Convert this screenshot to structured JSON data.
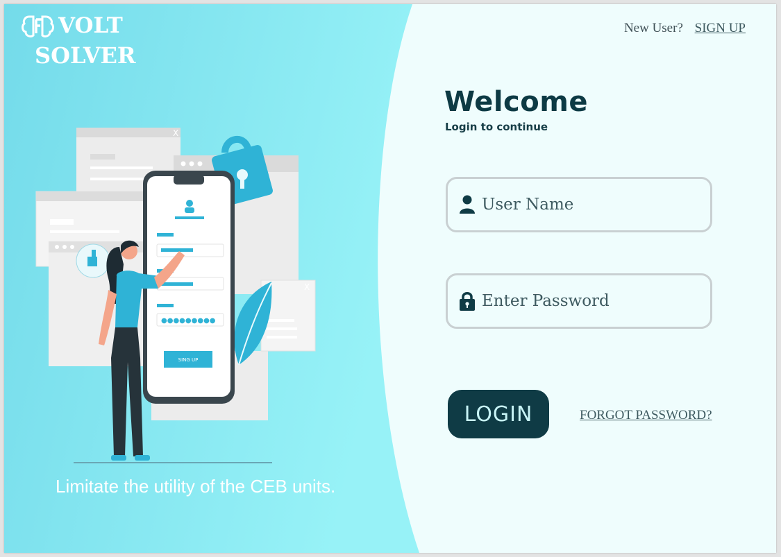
{
  "brand": {
    "line1": "VOLT",
    "line2": "SOLVER",
    "logo_icon": "brain-icon"
  },
  "header": {
    "new_user_text": "New User?",
    "signup_link": "SIGN UP"
  },
  "login": {
    "title": "Welcome",
    "subtitle": "Login to continue",
    "username_placeholder": "User Name",
    "password_placeholder": "Enter Password",
    "username_icon": "user-icon",
    "password_icon": "lock-icon",
    "login_button": "LOGIN",
    "forgot_link": "FORGOT PASSWORD?"
  },
  "illustration": {
    "phone_button_label": "SING UP"
  },
  "tagline": "Limitate the utility of the CEB units.",
  "colors": {
    "left_bg_start": "#74dbea",
    "left_bg_end": "#97f2f7",
    "right_bg": "#effdfd",
    "accent_dark": "#0f3b45",
    "illustration_blue": "#2fb3d6"
  }
}
